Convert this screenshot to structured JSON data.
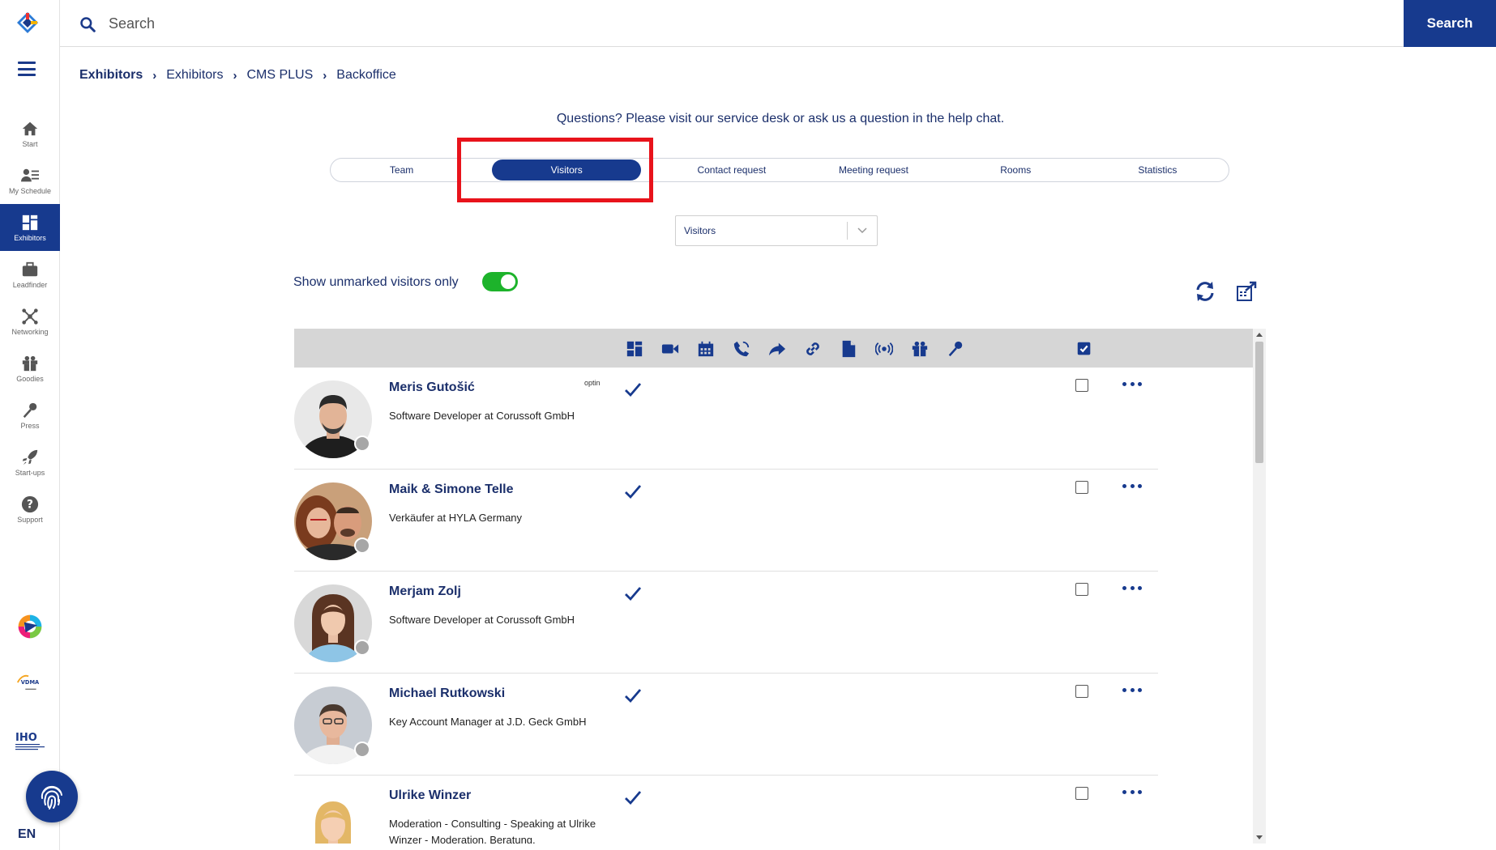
{
  "search": {
    "placeholder": "Search",
    "button": "Search"
  },
  "sidebar": {
    "items": [
      {
        "label": "Start",
        "icon": "home-icon"
      },
      {
        "label": "My Schedule",
        "icon": "schedule-icon"
      },
      {
        "label": "Exhibitors",
        "icon": "exhibitors-icon",
        "active": true
      },
      {
        "label": "Leadfinder",
        "icon": "briefcase-icon"
      },
      {
        "label": "Networking",
        "icon": "network-icon"
      },
      {
        "label": "Goodies",
        "icon": "gift-icon"
      },
      {
        "label": "Press",
        "icon": "microphone-icon"
      },
      {
        "label": "Start-ups",
        "icon": "rocket-icon"
      },
      {
        "label": "Support",
        "icon": "help-icon"
      }
    ],
    "partner_logos": {
      "vdma_logo_text": "VDMA",
      "iho_logo_text": "IHO"
    },
    "language": "EN"
  },
  "breadcrumb": [
    "Exhibitors",
    "Exhibitors",
    "CMS PLUS",
    "Backoffice"
  ],
  "help_text": "Questions? Please visit our service desk or ask us a question in the help chat.",
  "tabs": [
    "Team",
    "Visitors",
    "Contact request",
    "Meeting request",
    "Rooms",
    "Statistics"
  ],
  "active_tab": "Visitors",
  "filter_select": {
    "value": "Visitors"
  },
  "toggle": {
    "label": "Show unmarked visitors only",
    "on": true
  },
  "table_header_icons": [
    "exhibitors-icon",
    "video-icon",
    "calendar-icon",
    "phone-icon",
    "share-icon",
    "link-icon",
    "document-icon",
    "broadcast-icon",
    "gift-icon",
    "microphone-icon"
  ],
  "visitors": [
    {
      "name": "Meris Gutošić",
      "role": "Software Developer at Corussoft GmbH",
      "optin": "optin",
      "checked": true
    },
    {
      "name": "Maik & Simone Telle",
      "role": "Verkäufer at HYLA Germany",
      "optin": "",
      "checked": true
    },
    {
      "name": "Merjam Zolj",
      "role": "Software Developer at Corussoft GmbH",
      "optin": "",
      "checked": true
    },
    {
      "name": "Michael Rutkowski",
      "role": "Key Account Manager at J.D. Geck GmbH",
      "optin": "",
      "checked": true
    },
    {
      "name": "Ulrike Winzer",
      "role": "Moderation - Consulting - Speaking at Ulrike Winzer - Moderation, Beratung,",
      "optin": "",
      "checked": true
    }
  ],
  "colors": {
    "primary": "#173a8e",
    "toggle_on": "#1db32b",
    "highlight": "#e8131b"
  }
}
